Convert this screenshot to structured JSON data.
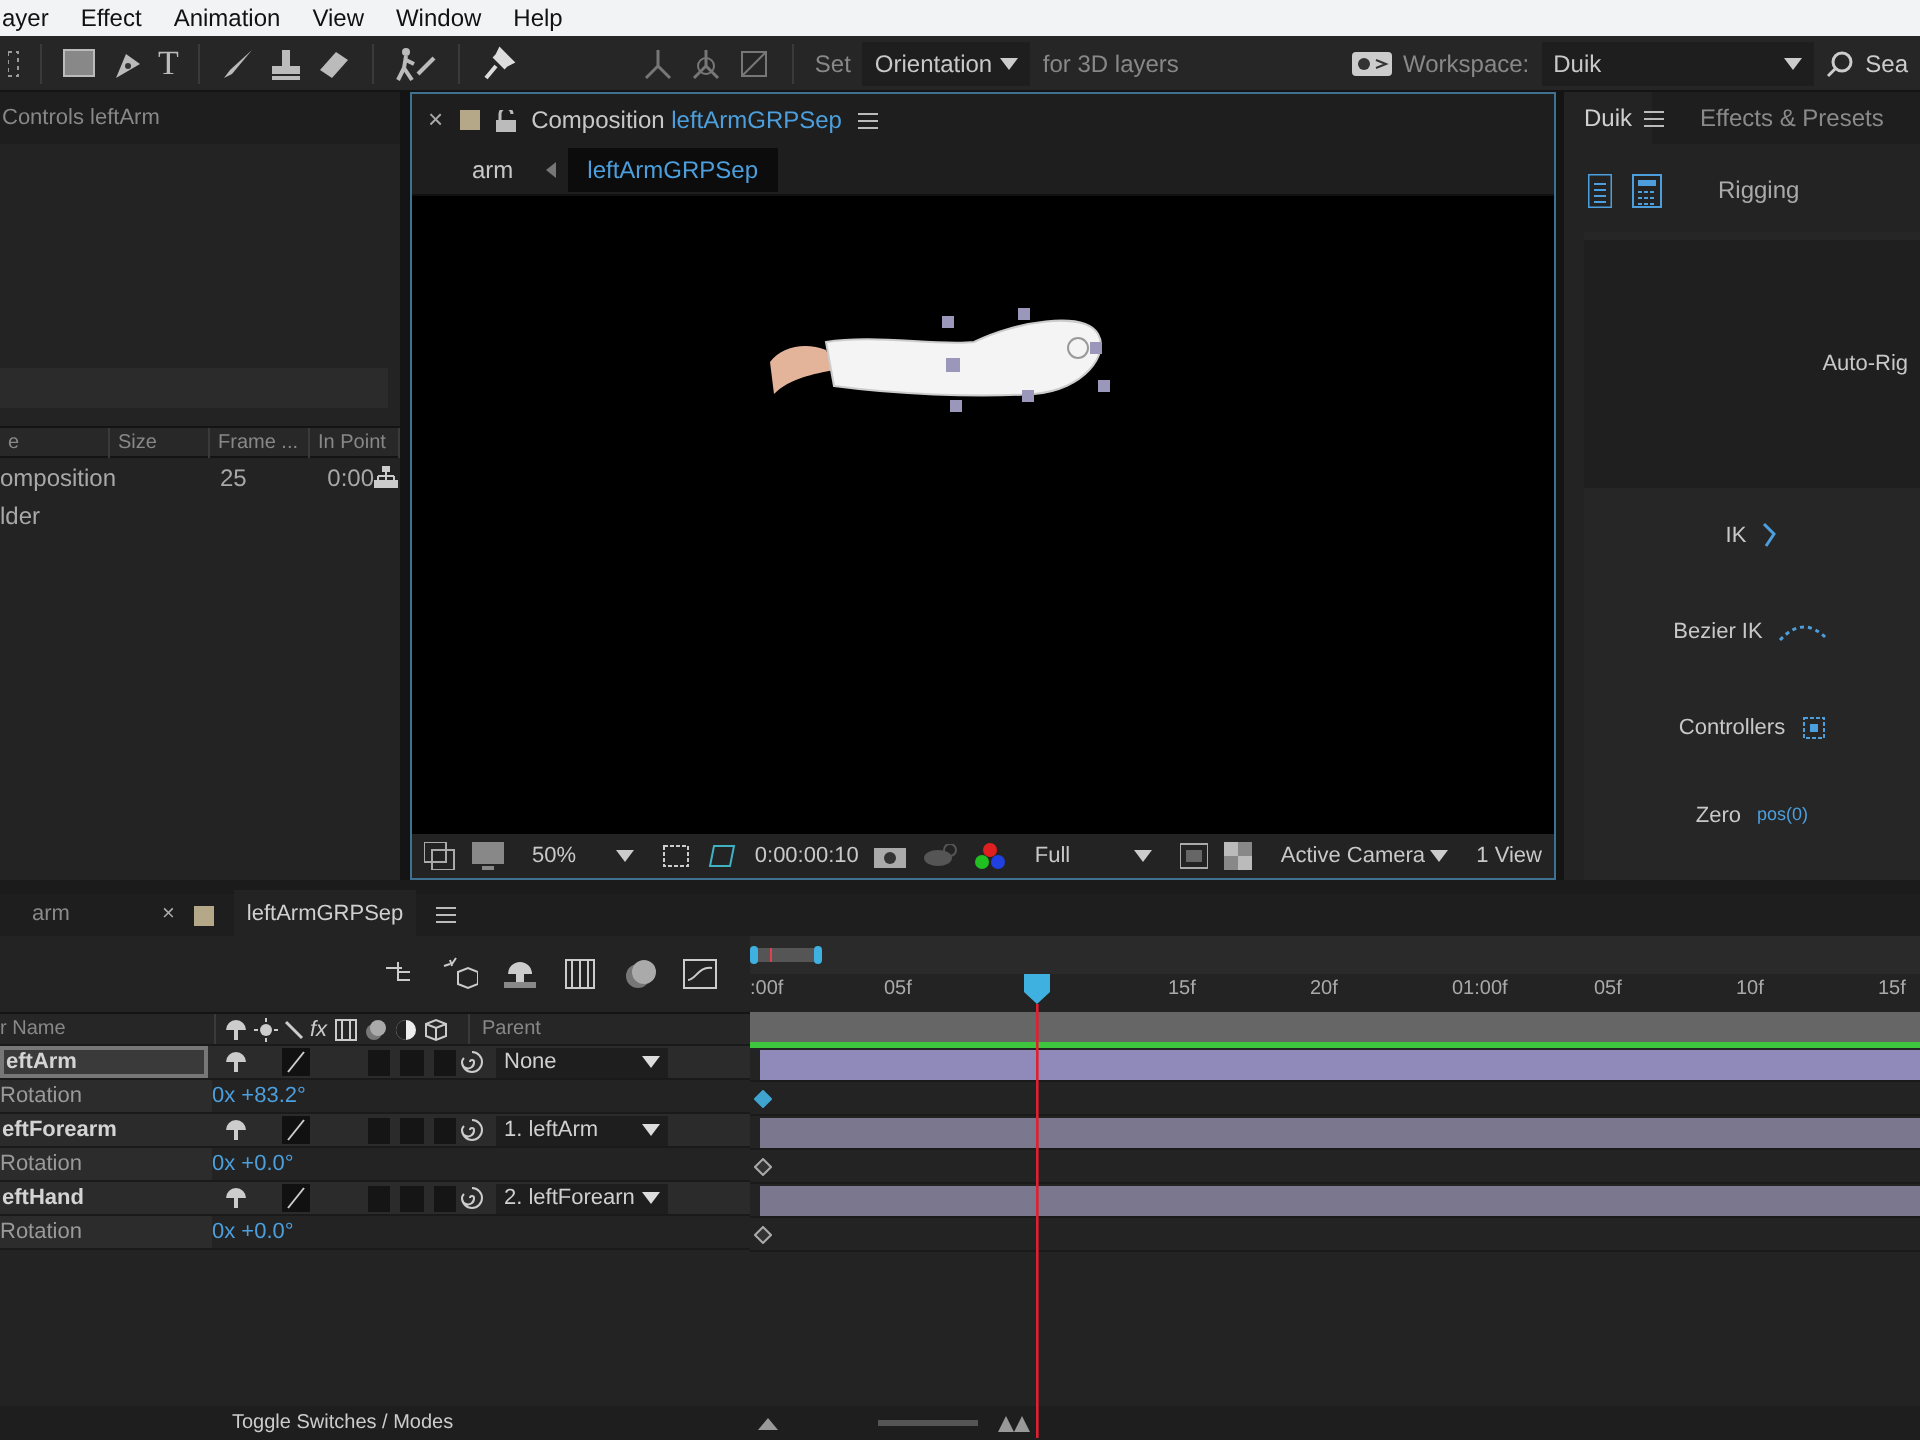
{
  "menu": [
    {
      "label": "ayer"
    },
    {
      "label": "Effect"
    },
    {
      "label": "Animation"
    },
    {
      "label": "View"
    },
    {
      "label": "Window"
    },
    {
      "label": "Help"
    }
  ],
  "toolbar": {
    "text_tool": "T",
    "set_label": "Set",
    "orientation": "Orientation",
    "for_3d": "for 3D layers",
    "workspace_label": "Workspace:",
    "workspace": "Duik",
    "search": "Sea"
  },
  "effect_controls": {
    "title": "Controls leftArm"
  },
  "project": {
    "columns": [
      "e",
      "Size",
      "Frame ...",
      "In Point"
    ],
    "rows": [
      {
        "name": "omposition",
        "frame_rate": "25",
        "in_point": "0:00"
      },
      {
        "name": "lder"
      }
    ]
  },
  "composition": {
    "close": "×",
    "tab_label": "Composition",
    "tab_name": "leftArmGRPSep",
    "breadcrumbs": [
      {
        "label": "arm",
        "selected": false
      },
      {
        "label": "leftArmGRPSep",
        "selected": true
      }
    ],
    "zoom": "50%",
    "timecode": "0:00:00:10",
    "resolution": "Full",
    "camera": "Active Camera",
    "views": "1 View"
  },
  "duik": {
    "tabs": [
      {
        "label": "Duik",
        "selected": true
      },
      {
        "label": "Effects & Presets",
        "selected": false
      }
    ],
    "section": "Rigging",
    "tools": [
      {
        "label": "Auto-Rig",
        "kind": "plain"
      },
      {
        "label": "IK",
        "kind": "ik"
      },
      {
        "label": "Bezier IK",
        "kind": "bezier"
      },
      {
        "label": "Controllers",
        "kind": "controller"
      },
      {
        "label": "Zero",
        "kind": "zero",
        "hint": "pos(0)"
      }
    ]
  },
  "timeline": {
    "close": "×",
    "fx_switch": "fx",
    "tabs": [
      {
        "label": "arm",
        "selected": false
      },
      {
        "label": "leftArmGRPSep",
        "selected": true
      }
    ],
    "name_column": "r Name",
    "parent_column": "Parent",
    "layers": [
      {
        "name": "eftArm",
        "selected": true,
        "parent": "None",
        "property": "Rotation",
        "value": "0x +83.2°",
        "keyframe_selected": true
      },
      {
        "name": "eftForearm",
        "selected": false,
        "parent": "1. leftArm",
        "property": "Rotation",
        "value": "0x +0.0°",
        "keyframe_selected": false
      },
      {
        "name": "eftHand",
        "selected": false,
        "parent": "2. leftForearn",
        "property": "Rotation",
        "value": "0x +0.0°",
        "keyframe_selected": false
      }
    ],
    "ruler": [
      ":00f",
      "05f",
      "15f",
      "20f",
      "01:00f",
      "05f",
      "10f",
      "15f"
    ],
    "current_time": {
      "level": 0.252
    },
    "toggle": "Toggle Switches / Modes"
  }
}
